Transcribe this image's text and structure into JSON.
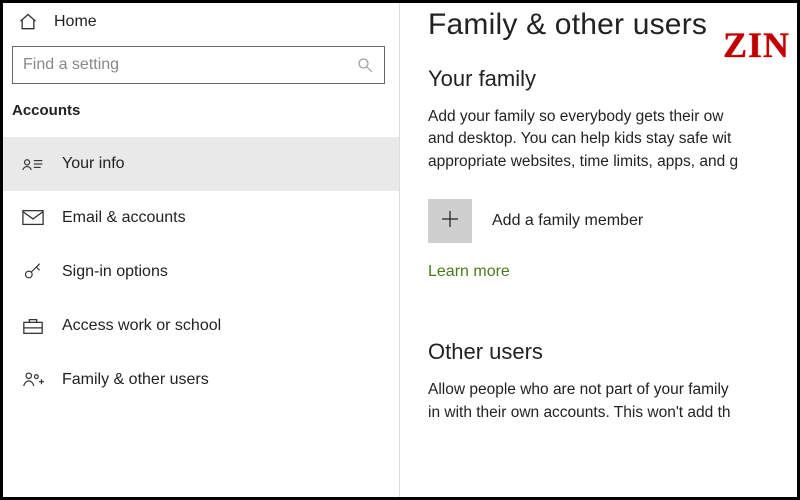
{
  "sidebar": {
    "home_label": "Home",
    "search_placeholder": "Find a setting",
    "section_label": "Accounts",
    "items": [
      {
        "label": "Your info",
        "icon": "person-card-icon",
        "selected": true
      },
      {
        "label": "Email & accounts",
        "icon": "mail-icon",
        "selected": false
      },
      {
        "label": "Sign-in options",
        "icon": "key-icon",
        "selected": false
      },
      {
        "label": "Access work or school",
        "icon": "briefcase-icon",
        "selected": false
      },
      {
        "label": "Family & other users",
        "icon": "people-plus-icon",
        "selected": false
      }
    ]
  },
  "content": {
    "page_title": "Family & other users",
    "family": {
      "heading": "Your family",
      "description": "Add your family so everybody gets their ow\nand desktop. You can help kids stay safe wit\nappropriate websites, time limits, apps, and g",
      "add_label": "Add a family member",
      "learn_more": "Learn more"
    },
    "other_users": {
      "heading": "Other users",
      "description": "Allow people who are not part of your family\nin with their own accounts. This won't add th"
    }
  },
  "watermark": "ZIN"
}
